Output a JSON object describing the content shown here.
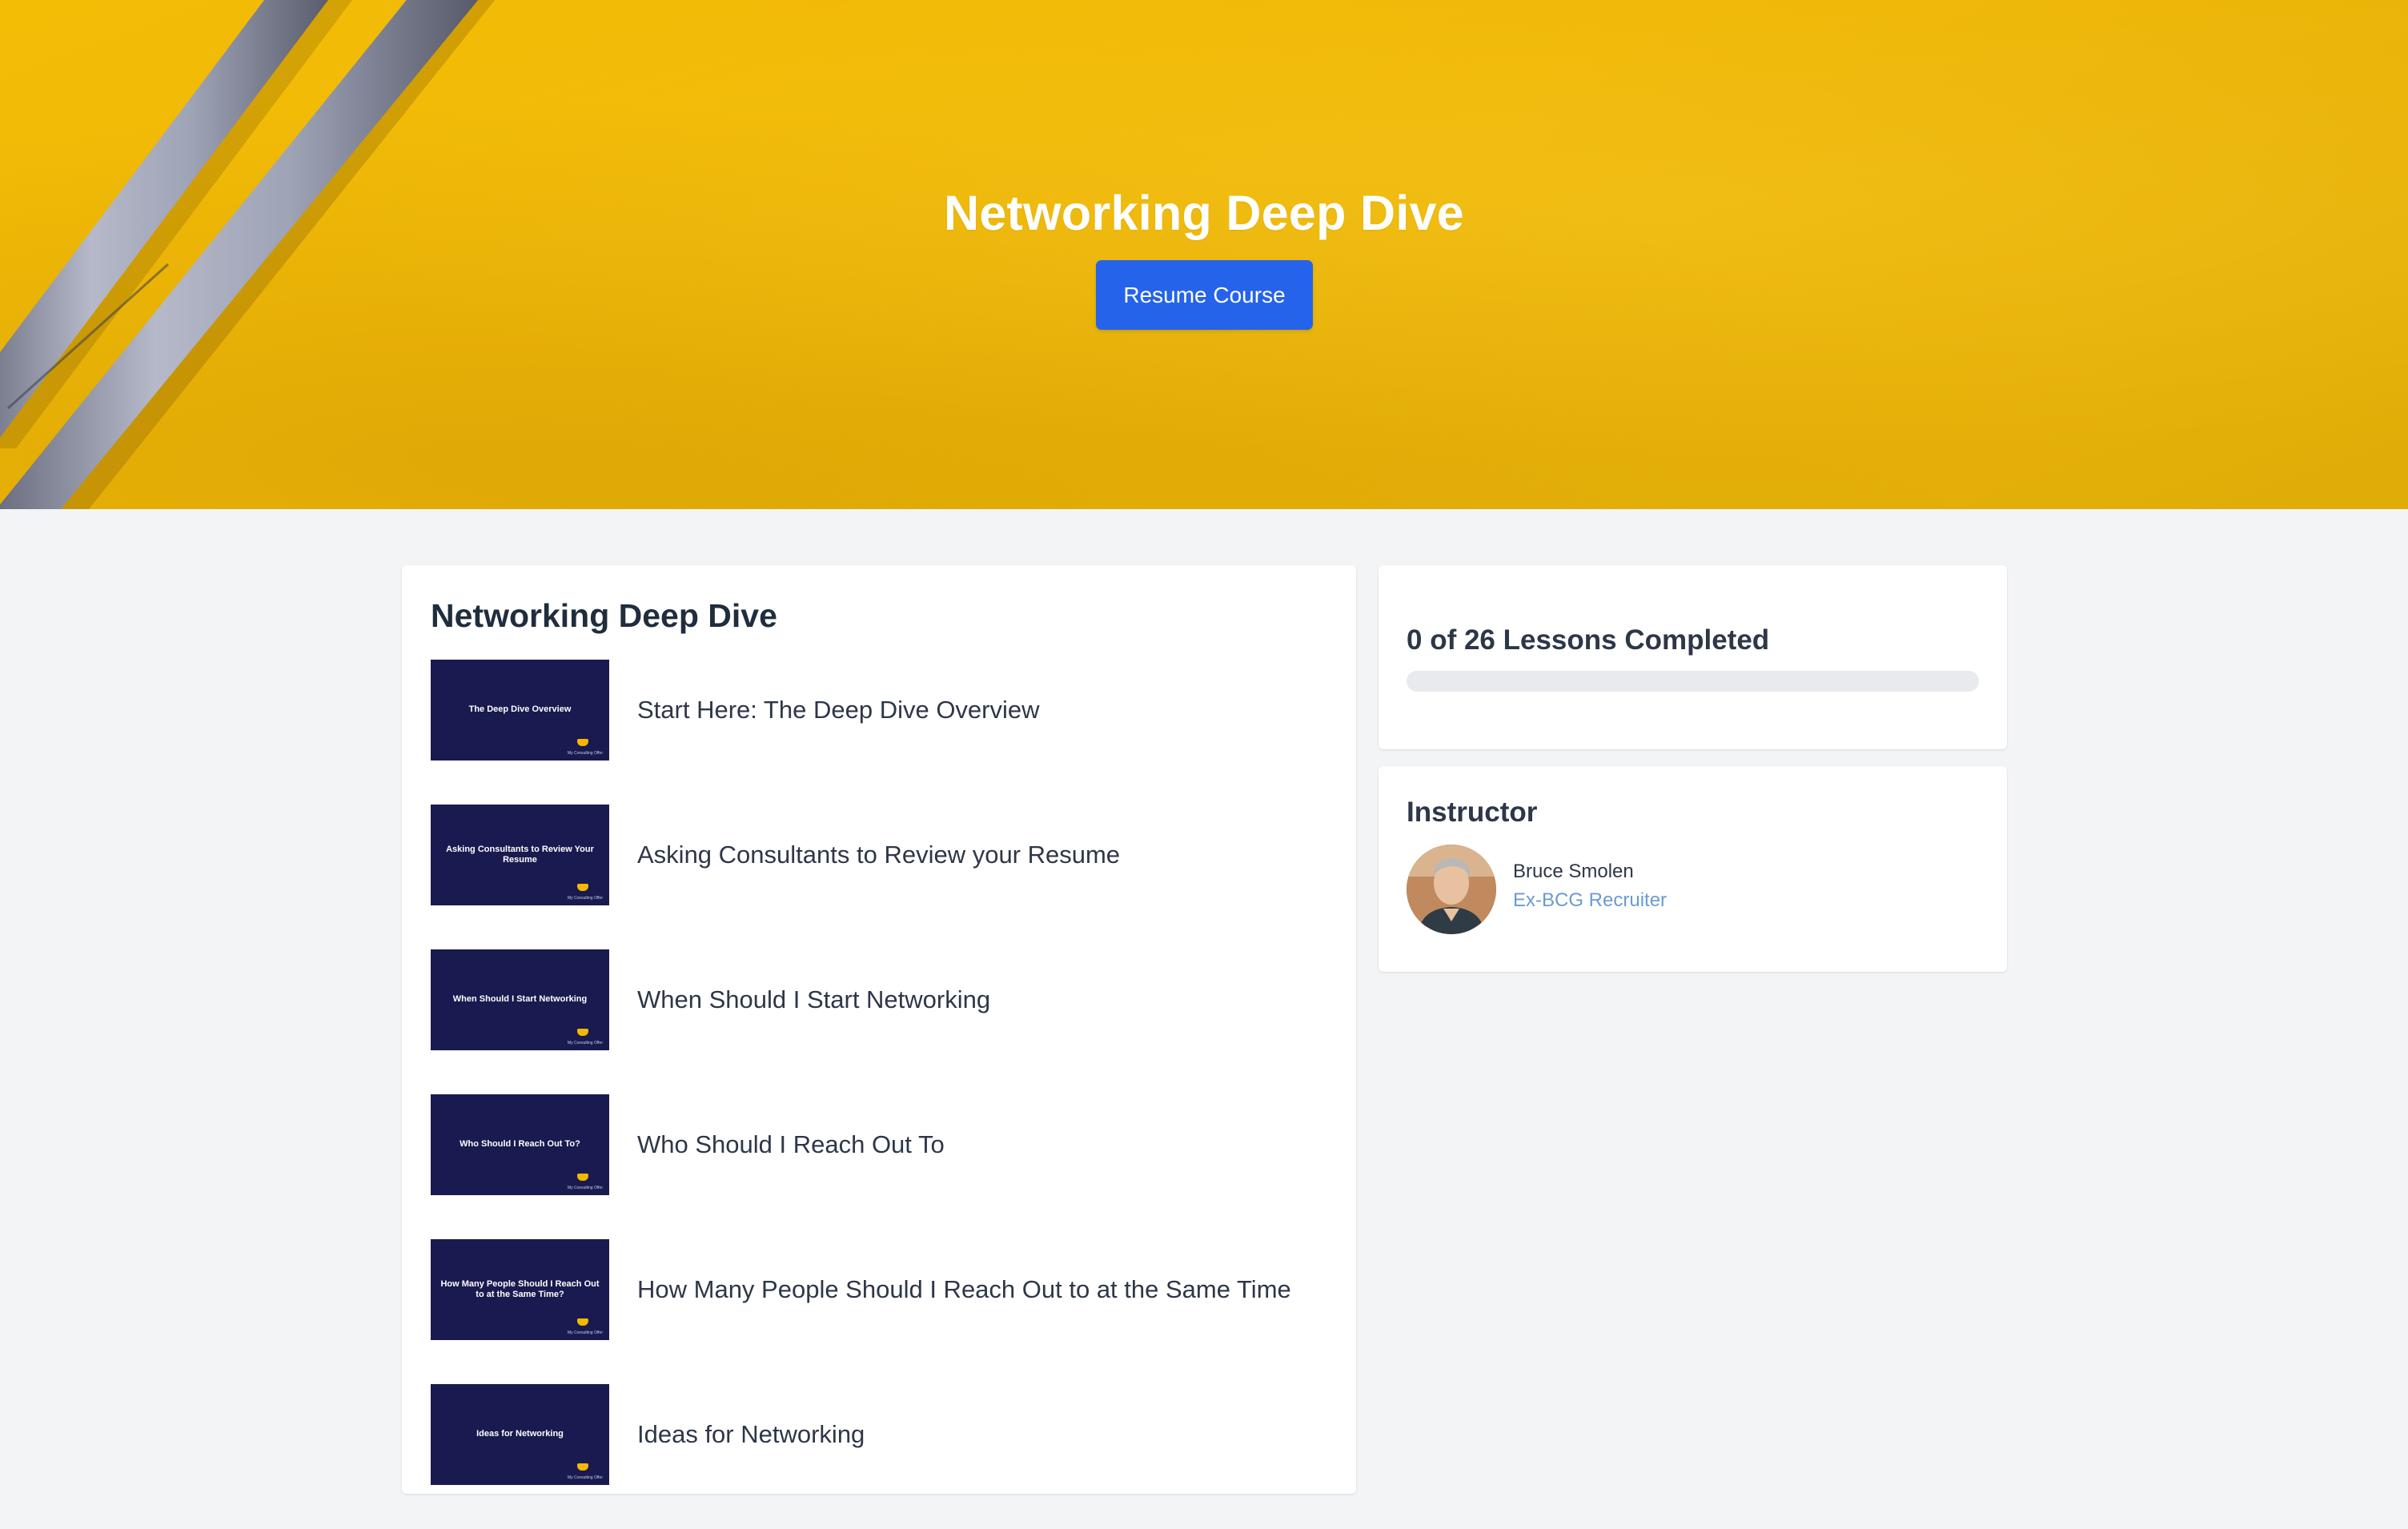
{
  "hero": {
    "title": "Networking Deep Dive",
    "resume_label": "Resume Course"
  },
  "lessons": {
    "title": "Networking Deep Dive",
    "items": [
      {
        "thumb": "The Deep Dive Overview",
        "label": "Start Here: The Deep Dive Overview"
      },
      {
        "thumb": "Asking Consultants to Review Your Resume",
        "label": "Asking Consultants to Review your Resume"
      },
      {
        "thumb": "When Should I Start Networking",
        "label": "When Should I Start Networking"
      },
      {
        "thumb": "Who Should I Reach Out To?",
        "label": "Who Should I Reach Out To"
      },
      {
        "thumb": "How Many People Should I Reach Out to at the Same Time?",
        "label": "How Many People Should I Reach Out to at the Same Time"
      },
      {
        "thumb": "Ideas for Networking",
        "label": "Ideas for Networking"
      }
    ],
    "thumb_brand": "My Consulting Offer"
  },
  "progress": {
    "text": "0 of 26 Lessons Completed",
    "completed": 0,
    "total": 26
  },
  "instructor": {
    "heading": "Instructor",
    "name": "Bruce Smolen",
    "role": "Ex-BCG Recruiter"
  },
  "colors": {
    "accent": "#2563eb",
    "hero_yellow": "#f0b807",
    "thumb_navy": "#191a4f",
    "link_blue": "#6b9bd1"
  }
}
